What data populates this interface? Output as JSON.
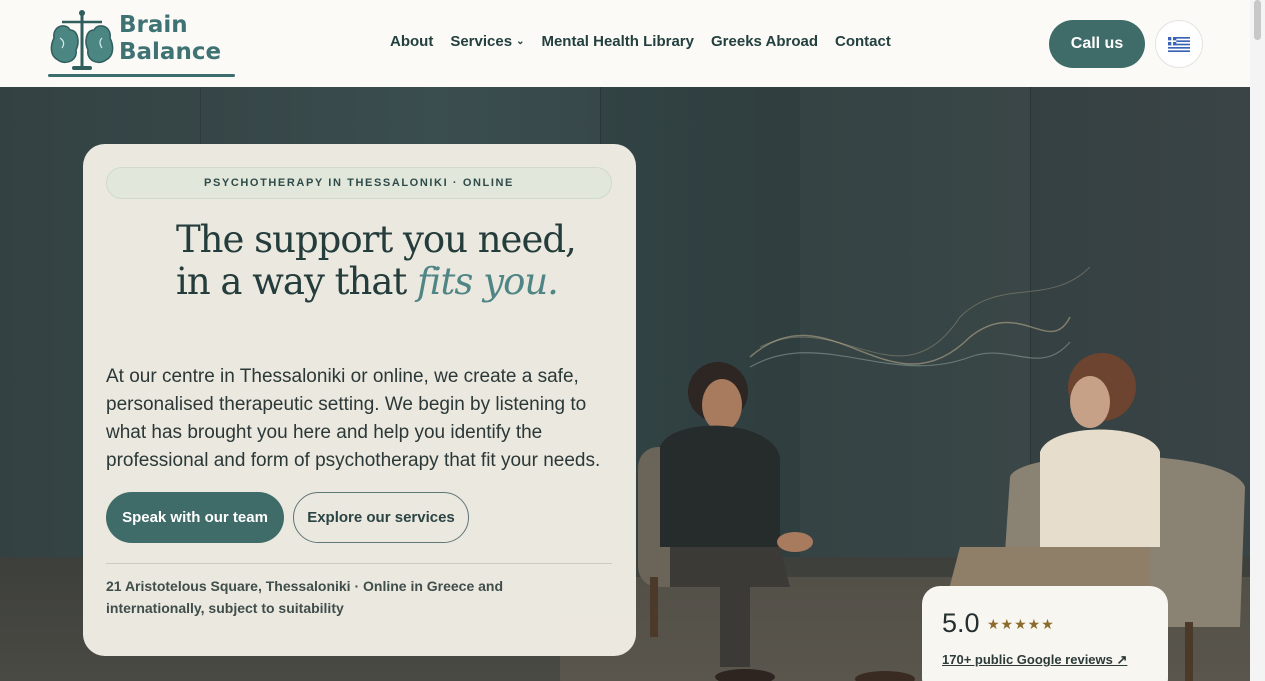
{
  "brand": {
    "name_line1": "Brain",
    "name_line2": "Balance",
    "logo_icon": "brain-scales-logo"
  },
  "nav": {
    "items": [
      "About",
      "Services",
      "Mental Health Library",
      "Greeks Abroad",
      "Contact"
    ],
    "services_chevron": "⌄"
  },
  "header": {
    "call_label": "Call us",
    "language_icon": "greek-flag-icon"
  },
  "hero": {
    "eyebrow": "PSYCHOTHERAPY IN THESSALONIKI · ONLINE",
    "headline_part1": "The support you need, in a way that ",
    "headline_accent": "fits you.",
    "body": "At our centre in Thessaloniki or online, we create a safe, personalised therapeutic setting. We begin by listening to what has brought you here and help you identify the professional and form of psychotherapy that fit your needs.",
    "primary_cta": "Speak with our team",
    "secondary_cta": "Explore our services",
    "address": "21 Aristotelous Square, Thessaloniki · Online in Greece and internationally, subject to suitability"
  },
  "rating": {
    "score": "5.0",
    "stars": "★★★★★",
    "reviews_link": "170+ public Google reviews ↗"
  },
  "colors": {
    "accent": "#3f6b68",
    "headline": "#243c3b",
    "accent_text": "#4f8585"
  }
}
